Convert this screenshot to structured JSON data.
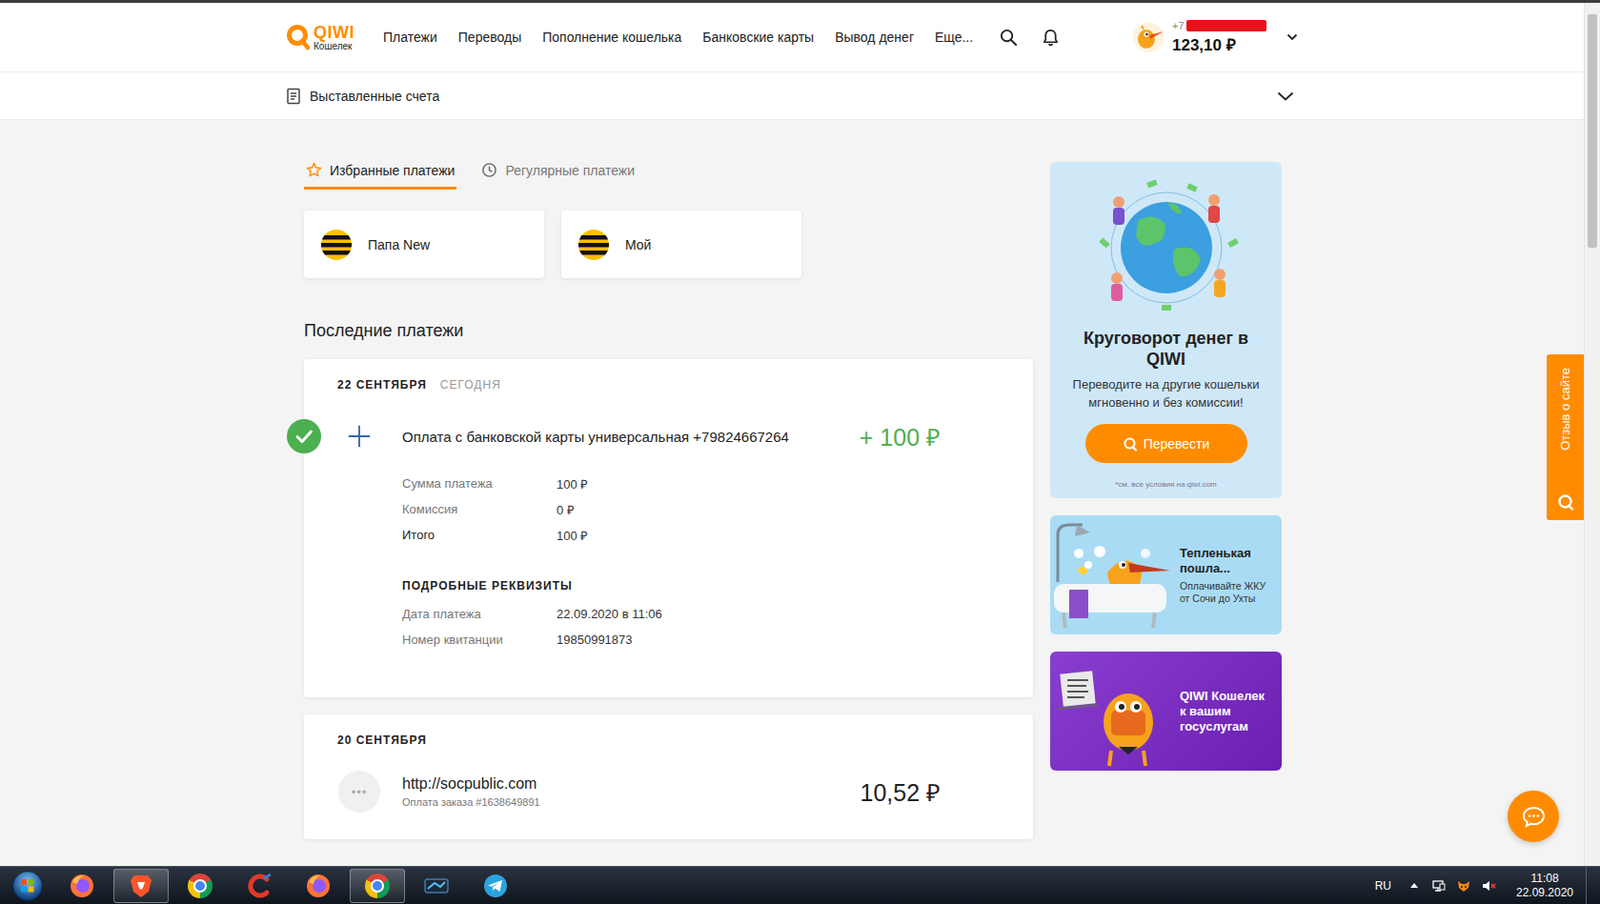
{
  "header": {
    "logo": {
      "name": "QIWI",
      "subtitle": "Кошелек"
    },
    "nav": [
      {
        "label": "Платежи"
      },
      {
        "label": "Переводы"
      },
      {
        "label": "Пополнение кошелька"
      },
      {
        "label": "Банковские карты"
      },
      {
        "label": "Вывод денег"
      },
      {
        "label": "Еще..."
      }
    ],
    "account": {
      "phone": "+7",
      "phone_redacted": true,
      "balance": "123,10 ₽"
    }
  },
  "invoices": {
    "label": "Выставленные счета",
    "expanded": false
  },
  "tabs": [
    {
      "kind": "favorites",
      "label": "Избранные платежи",
      "selected": true
    },
    {
      "kind": "regular",
      "label": "Регулярные платежи",
      "selected": false
    }
  ],
  "favorites": [
    {
      "name": "Папа New"
    },
    {
      "name": "Мой"
    }
  ],
  "recent": {
    "title": "Последние платежи",
    "days": [
      {
        "date": "22 СЕНТЯБРЯ",
        "note": "СЕГОДНЯ",
        "payments": [
          {
            "kind": "topup",
            "status": "success",
            "expanded": true,
            "icon": "",
            "title": "Оплата с банковской карты универсальная +79824667264",
            "subtitle": "",
            "amount": "+ 100 ₽",
            "income": true,
            "summary": [
              {
                "label": "Сумма платежа",
                "value": "100 ₽",
                "strong": false
              },
              {
                "label": "Комиссия",
                "value": "0 ₽",
                "strong": false
              },
              {
                "label": "Итого",
                "value": "100 ₽",
                "strong": true
              }
            ],
            "requisites_title": "ПОДРОБНЫЕ РЕКВИЗИТЫ",
            "requisites": [
              {
                "label": "Дата платежа",
                "value": "22.09.2020 в 11:06"
              },
              {
                "label": "Номер квитанции",
                "value": "19850991873"
              }
            ]
          }
        ]
      },
      {
        "date": "20 СЕНТЯБРЯ",
        "note": "",
        "payments": [
          {
            "kind": "order",
            "status": "none",
            "expanded": false,
            "icon": "•••",
            "title": "http://socpublic.com",
            "subtitle": "Оплата заказа #1638649891",
            "amount": "10,52 ₽",
            "income": false,
            "summary": [],
            "requisites_title": "",
            "requisites": []
          }
        ]
      }
    ]
  },
  "sidebar": {
    "banners": [
      {
        "kind": "transfer",
        "title": "Круговорот денег в QIWI",
        "text": "Переводите на другие кошельки мгновенно и без комиссии!",
        "button": "Перевести",
        "note": "*см. все условия на qiwi.com"
      },
      {
        "kind": "utilities",
        "title": "Тепленькая пошла...",
        "text": "Оплачивайте ЖКУ от Сочи до Ухты",
        "button": "",
        "note": ""
      },
      {
        "kind": "gosuslugi",
        "title": "QIWI Кошелек к вашим госуслугам",
        "text": "",
        "button": "",
        "note": ""
      }
    ]
  },
  "feedback": {
    "label": "Отзыв о сайте"
  },
  "scrollbar": {
    "level": 0.27
  },
  "taskbar": {
    "apps": [
      {
        "kind": "firefox",
        "active": false
      },
      {
        "kind": "brave",
        "active": true
      },
      {
        "kind": "chrome",
        "active": false
      },
      {
        "kind": "ccleaner",
        "active": false
      },
      {
        "kind": "firefox",
        "active": false
      },
      {
        "kind": "chrome",
        "active": true
      },
      {
        "kind": "app",
        "active": false
      },
      {
        "kind": "telegram",
        "active": false
      }
    ],
    "tray": {
      "lang": "RU",
      "time": "11:08",
      "date": "22.09.2020"
    }
  }
}
